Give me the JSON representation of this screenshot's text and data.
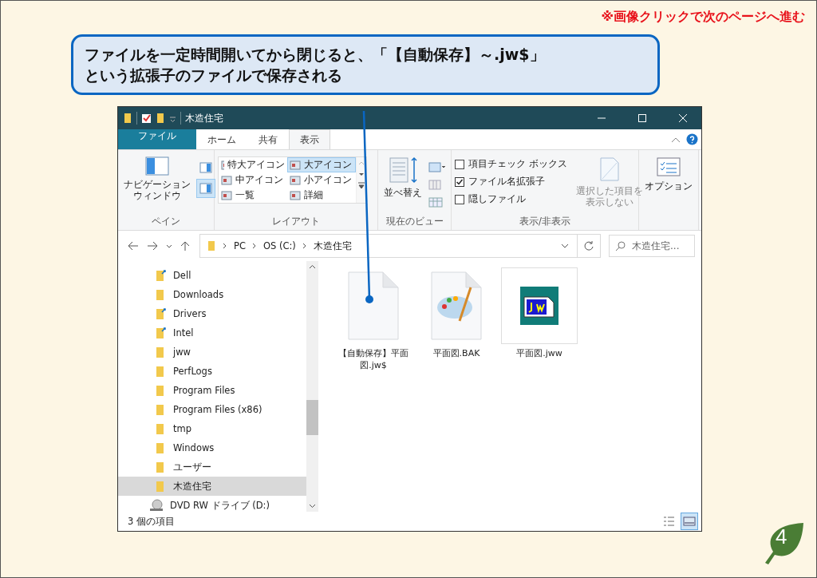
{
  "notice": "※画像クリックで次のページへ進む",
  "callout": {
    "lines": [
      "ファイルを一定時間開いてから閉じると、「【自動保存】～.jw$」",
      "という拡張子のファイルで保存される"
    ]
  },
  "window": {
    "title": "木造住宅"
  },
  "ribbon_tabs": [
    {
      "label": "ファイル",
      "kind": "file",
      "selected": false
    },
    {
      "label": "ホーム",
      "kind": "tab",
      "selected": false
    },
    {
      "label": "共有",
      "kind": "tab",
      "selected": false
    },
    {
      "label": "表示",
      "kind": "tab",
      "selected": true
    }
  ],
  "ribbon": {
    "pane": {
      "button_lines": [
        "ナビゲーション",
        "ウィンドウ"
      ],
      "label": "ペイン"
    },
    "layout": {
      "items": [
        {
          "label": "特大アイコン",
          "selected": false
        },
        {
          "label": "大アイコン",
          "selected": true
        },
        {
          "label": "中アイコン",
          "selected": false
        },
        {
          "label": "小アイコン",
          "selected": false
        },
        {
          "label": "一覧",
          "selected": false
        },
        {
          "label": "詳細",
          "selected": false
        }
      ],
      "label": "レイアウト"
    },
    "current_view": {
      "sort_label": "並べ替え",
      "label": "現在のビュー"
    },
    "show_hide": {
      "checkboxes": [
        {
          "label": "項目チェック ボックス",
          "checked": false
        },
        {
          "label": "ファイル名拡張子",
          "checked": true
        },
        {
          "label": "隠しファイル",
          "checked": false
        }
      ],
      "hide_button": {
        "lines": [
          "選択した項目を",
          "表示しない"
        ],
        "disabled": true
      },
      "label": "表示/非表示"
    },
    "options": {
      "label": "オプション"
    }
  },
  "address": {
    "crumbs": [
      "PC",
      "OS (C:)",
      "木造住宅"
    ],
    "search_placeholder": "木造住宅..."
  },
  "nav_items": [
    {
      "label": "Dell",
      "kind": "linked",
      "selected": false
    },
    {
      "label": "Downloads",
      "kind": "folder",
      "selected": false
    },
    {
      "label": "Drivers",
      "kind": "linked",
      "selected": false
    },
    {
      "label": "Intel",
      "kind": "linked",
      "selected": false
    },
    {
      "label": "jww",
      "kind": "folder",
      "selected": false
    },
    {
      "label": "PerfLogs",
      "kind": "folder",
      "selected": false
    },
    {
      "label": "Program Files",
      "kind": "folder",
      "selected": false
    },
    {
      "label": "Program Files (x86)",
      "kind": "folder",
      "selected": false
    },
    {
      "label": "tmp",
      "kind": "folder",
      "selected": false
    },
    {
      "label": "Windows",
      "kind": "folder",
      "selected": false
    },
    {
      "label": "ユーザー",
      "kind": "folder",
      "selected": false
    },
    {
      "label": "木造住宅",
      "kind": "folder",
      "selected": true
    },
    {
      "label": "DVD RW ドライブ (D:)",
      "kind": "drive",
      "selected": false
    }
  ],
  "files": [
    {
      "name": "【自動保存】平面図.jw$",
      "kind": "blank"
    },
    {
      "name": "平面図.BAK",
      "kind": "paint"
    },
    {
      "name": "平面図.jww",
      "kind": "jww"
    }
  ],
  "status_bar": {
    "text": "3 個の項目",
    "views": [
      {
        "kind": "details",
        "selected": false
      },
      {
        "kind": "large",
        "selected": true
      }
    ]
  },
  "page_number": "4"
}
